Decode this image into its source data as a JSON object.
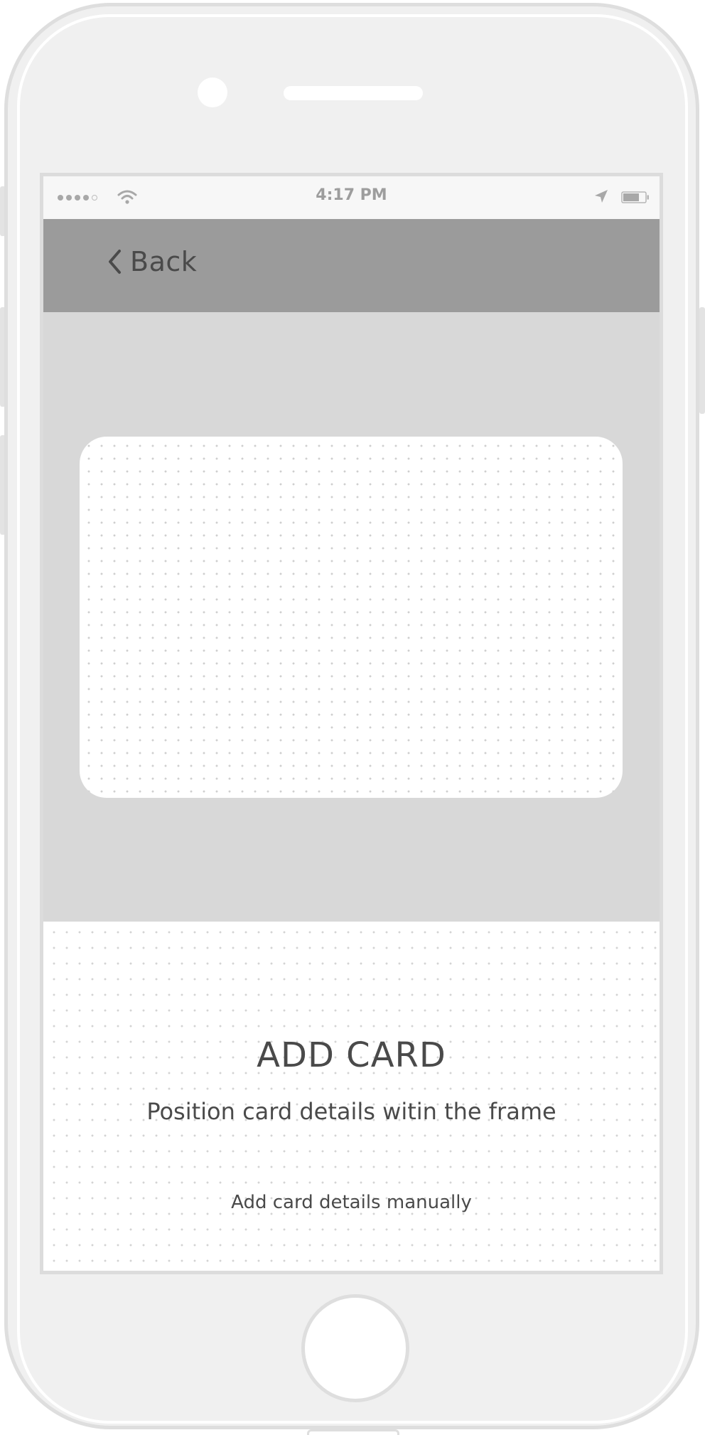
{
  "status_bar": {
    "time": "4:17 PM",
    "signal_bars_filled": 4,
    "signal_bars_total": 5
  },
  "nav": {
    "back_label": "Back"
  },
  "scanner": {
    "title": "ADD CARD",
    "instruction": "Position card details witin the frame",
    "manual_entry_label": "Add card details manually"
  },
  "colors": {
    "nav_bar": "#9b9b9b",
    "camera_area": "#d8d8d8",
    "text": "#4a4a4a",
    "device_body": "#f0f0f0"
  },
  "icons": [
    "wifi-icon",
    "location-arrow-icon",
    "battery-icon",
    "chevron-left-icon"
  ]
}
